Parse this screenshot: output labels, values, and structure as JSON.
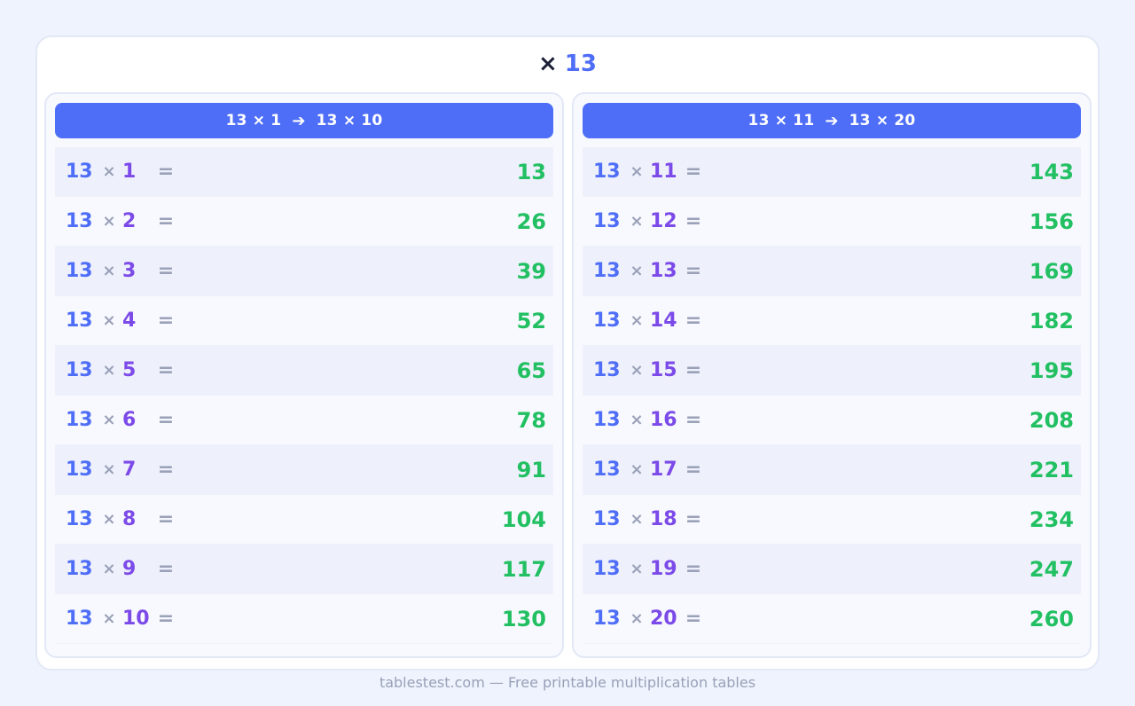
{
  "title": {
    "times_symbol": "×",
    "number": "13"
  },
  "symbols": {
    "times": "×",
    "equals": "="
  },
  "panels": [
    {
      "header": {
        "from": "13 × 1",
        "arrow": "➔",
        "to": "13 × 10"
      },
      "rows": [
        {
          "a": "13",
          "b": "1",
          "result": "13"
        },
        {
          "a": "13",
          "b": "2",
          "result": "26"
        },
        {
          "a": "13",
          "b": "3",
          "result": "39"
        },
        {
          "a": "13",
          "b": "4",
          "result": "52"
        },
        {
          "a": "13",
          "b": "5",
          "result": "65"
        },
        {
          "a": "13",
          "b": "6",
          "result": "78"
        },
        {
          "a": "13",
          "b": "7",
          "result": "91"
        },
        {
          "a": "13",
          "b": "8",
          "result": "104"
        },
        {
          "a": "13",
          "b": "9",
          "result": "117"
        },
        {
          "a": "13",
          "b": "10",
          "result": "130"
        }
      ]
    },
    {
      "header": {
        "from": "13 × 11",
        "arrow": "➔",
        "to": "13 × 20"
      },
      "rows": [
        {
          "a": "13",
          "b": "11",
          "result": "143"
        },
        {
          "a": "13",
          "b": "12",
          "result": "156"
        },
        {
          "a": "13",
          "b": "13",
          "result": "169"
        },
        {
          "a": "13",
          "b": "14",
          "result": "182"
        },
        {
          "a": "13",
          "b": "15",
          "result": "195"
        },
        {
          "a": "13",
          "b": "16",
          "result": "208"
        },
        {
          "a": "13",
          "b": "17",
          "result": "221"
        },
        {
          "a": "13",
          "b": "18",
          "result": "234"
        },
        {
          "a": "13",
          "b": "19",
          "result": "247"
        },
        {
          "a": "13",
          "b": "20",
          "result": "260"
        }
      ]
    }
  ],
  "footer": "tablestest.com — Free printable multiplication tables",
  "colors": {
    "accent": "#4f6ef7",
    "multiplier": "#7c4ae8",
    "result": "#22c062",
    "muted": "#9aa1b8"
  }
}
